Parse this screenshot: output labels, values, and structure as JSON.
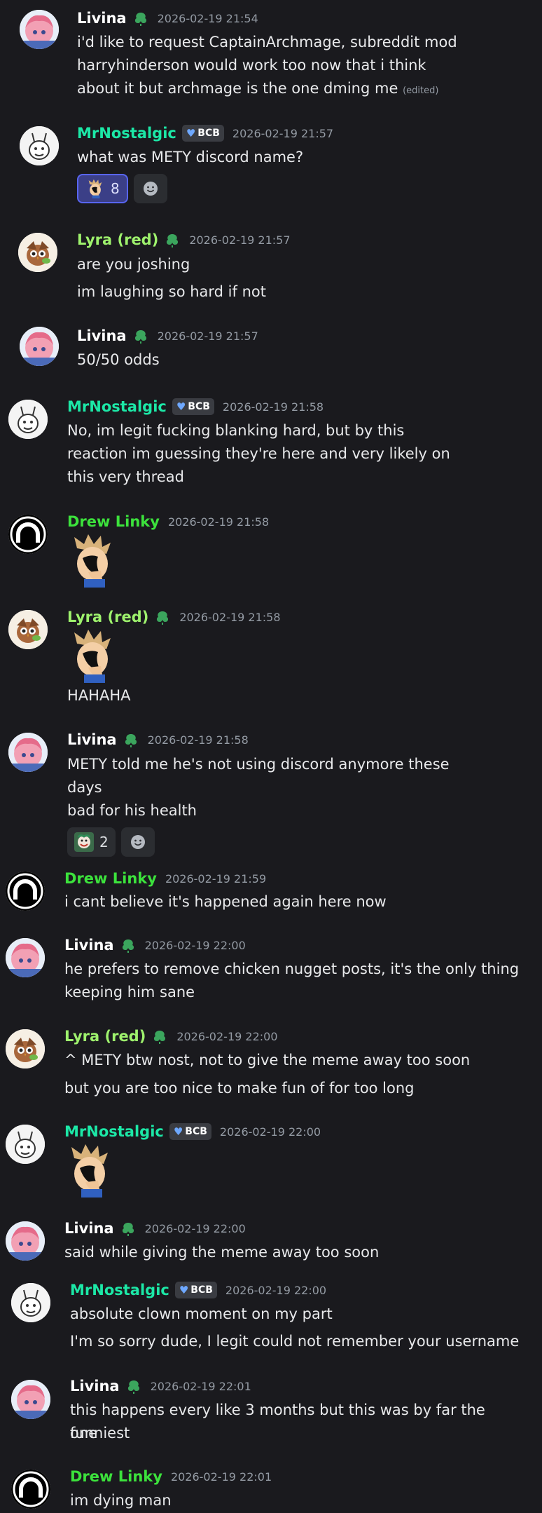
{
  "colors": {
    "livina": "#ffffff",
    "mrnostalgic": "#1ce8a7",
    "lyra": "#9ef26d",
    "drew": "#3ce23c",
    "bcb_heart": "#6ea8ff"
  },
  "messages": [
    {
      "user": "Livina",
      "time": "2026-02-19 21:54",
      "text1": "i'd like to request CaptainArchmage, subreddit mod",
      "text2": "harryhinderson would work too now that i think",
      "text3": "about it but archmage is the one dming me",
      "edited": "(edited)"
    },
    {
      "user": "MrNostalgic",
      "tag": "BCB",
      "time": "2026-02-19 21:57",
      "text1": "what was METY discord name?",
      "reaction_count": "8"
    },
    {
      "user": "Lyra (red)",
      "time": "2026-02-19 21:57",
      "text1": "are you joshing",
      "text2": "im laughing so hard if not"
    },
    {
      "user": "Livina",
      "time": "2026-02-19 21:57",
      "text1": "50/50 odds"
    },
    {
      "user": "MrNostalgic",
      "tag": "BCB",
      "time": "2026-02-19 21:58",
      "text1": "No, im legit fucking blanking hard, but by this",
      "text2": "reaction im guessing they're here and very likely on",
      "text3": "this very thread"
    },
    {
      "user": "Drew Linky",
      "time": "2026-02-19 21:58"
    },
    {
      "user": "Lyra (red)",
      "time": "2026-02-19 21:58",
      "text1": "HAHAHA"
    },
    {
      "user": "Livina",
      "time": "2026-02-19 21:58",
      "text1": "METY told me he's not using discord anymore these",
      "text2": "days",
      "text3": "bad for his health",
      "reaction_count": "2"
    },
    {
      "user": "Drew Linky",
      "time": "2026-02-19 21:59",
      "text1": "i cant believe it's happened again here now"
    },
    {
      "user": "Livina",
      "time": "2026-02-19 22:00",
      "text1": "he prefers to remove chicken nugget posts, it's the only thing",
      "text2": "keeping him sane"
    },
    {
      "user": "Lyra (red)",
      "time": "2026-02-19 22:00",
      "text1": "^ METY btw nost, not to give the meme away too soon",
      "text2": "but you are too nice to make fun of for too long"
    },
    {
      "user": "MrNostalgic",
      "tag": "BCB",
      "time": "2026-02-19 22:00"
    },
    {
      "user": "Livina",
      "time": "2026-02-19 22:00",
      "text1": "said while giving the meme away too soon"
    },
    {
      "user": "MrNostalgic",
      "tag": "BCB",
      "time": "2026-02-19 22:00",
      "text1": "absolute clown moment on my part",
      "text2": "I'm so sorry dude, I legit could not remember your username"
    },
    {
      "user": "Livina",
      "time": "2026-02-19 22:01",
      "text1": "this happens every like 3 months but this was by far the funniest",
      "text2": "one"
    },
    {
      "user": "Drew Linky",
      "time": "2026-02-19 22:01",
      "text1": "im dying man"
    }
  ]
}
